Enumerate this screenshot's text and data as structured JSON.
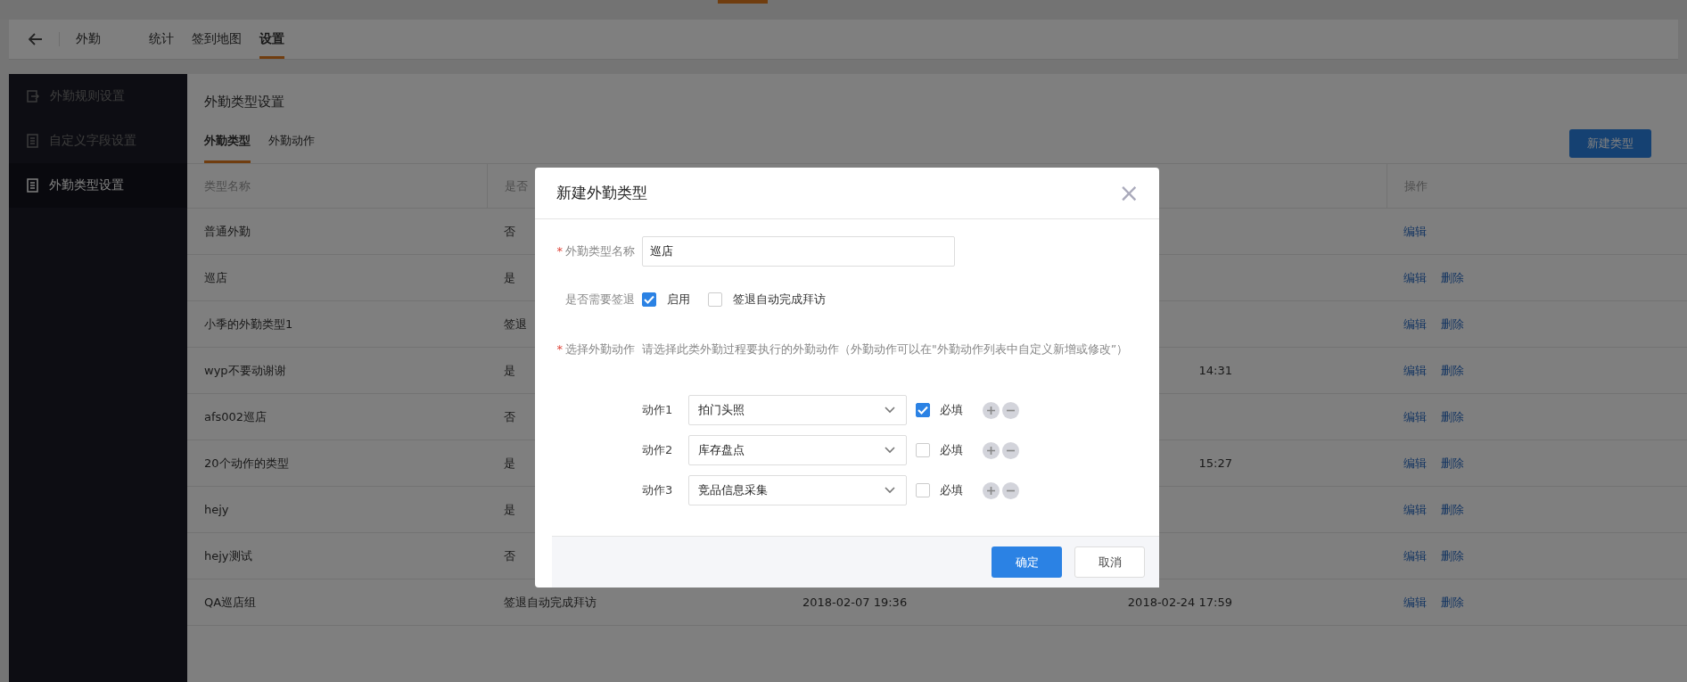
{
  "header": {
    "title": "外勤",
    "tabs": [
      {
        "label": "统计",
        "selected": false
      },
      {
        "label": "签到地图",
        "selected": false
      },
      {
        "label": "设置",
        "selected": true
      }
    ]
  },
  "sidebar": {
    "items": [
      {
        "label": "外勤规则设置",
        "kind": "exit",
        "selected": false
      },
      {
        "label": "自定义字段设置",
        "kind": "document",
        "selected": false
      },
      {
        "label": "外勤类型设置",
        "kind": "document",
        "selected": true
      }
    ]
  },
  "content": {
    "title": "外勤类型设置",
    "tabs": [
      {
        "label": "外勤类型",
        "selected": true
      },
      {
        "label": "外勤动作",
        "selected": false
      }
    ],
    "new_button": "新建类型",
    "table": {
      "columns": [
        "类型名称",
        "是否"
      ],
      "action_column": "操作",
      "rows": [
        {
          "cells": [
            "普通外勤",
            "否"
          ],
          "actions": [
            "编辑"
          ]
        },
        {
          "cells": [
            "巡店",
            "是"
          ],
          "actions": [
            "编辑",
            "删除"
          ]
        },
        {
          "cells": [
            "小季的外勤类型1",
            "签退"
          ],
          "actions": [
            "编辑",
            "删除"
          ]
        },
        {
          "cells": [
            "wyp不要动谢谢",
            "是",
            "",
            "14:31"
          ],
          "actions": [
            "编辑",
            "删除"
          ]
        },
        {
          "cells": [
            "afs002巡店",
            "否"
          ],
          "actions": [
            "编辑",
            "删除"
          ]
        },
        {
          "cells": [
            "20个动作的类型",
            "是",
            "",
            "15:27"
          ],
          "actions": [
            "编辑",
            "删除"
          ]
        },
        {
          "cells": [
            "hejy",
            "是"
          ],
          "actions": [
            "编辑",
            "删除"
          ]
        },
        {
          "cells": [
            "hejy测试",
            "否"
          ],
          "actions": [
            "编辑",
            "删除"
          ]
        },
        {
          "cells": [
            "QA巡店组",
            "签退自动完成拜访",
            "2018-02-07 19:36",
            "2018-02-24 17:59"
          ],
          "actions": [
            "编辑",
            "删除"
          ]
        }
      ]
    }
  },
  "dialog": {
    "title": "新建外勤类型",
    "close": "×",
    "name_field": {
      "required_mark": "*",
      "label": "外勤类型名称",
      "value": "巡店"
    },
    "checkout": {
      "label": "是否需要签退",
      "options": [
        {
          "label": "启用",
          "checked": true
        },
        {
          "label": "签退自动完成拜访",
          "checked": false
        }
      ]
    },
    "actions_field": {
      "required_mark": "*",
      "label": "选择外勤动作",
      "hint": "请选择此类外勤过程要执行的外勤动作（外勤动作可以在\"外勤动作列表中自定义新增或修改”）"
    },
    "actions": [
      {
        "label": "动作1",
        "value": "拍门头照",
        "required_label": "必填",
        "required": true
      },
      {
        "label": "动作2",
        "value": "库存盘点",
        "required_label": "必填",
        "required": false
      },
      {
        "label": "动作3",
        "value": "竞品信息采集",
        "required_label": "必填",
        "required": false
      }
    ],
    "buttons": [
      {
        "label": "确定",
        "kind": "primary"
      },
      {
        "label": "取消",
        "kind": "default"
      }
    ]
  }
}
